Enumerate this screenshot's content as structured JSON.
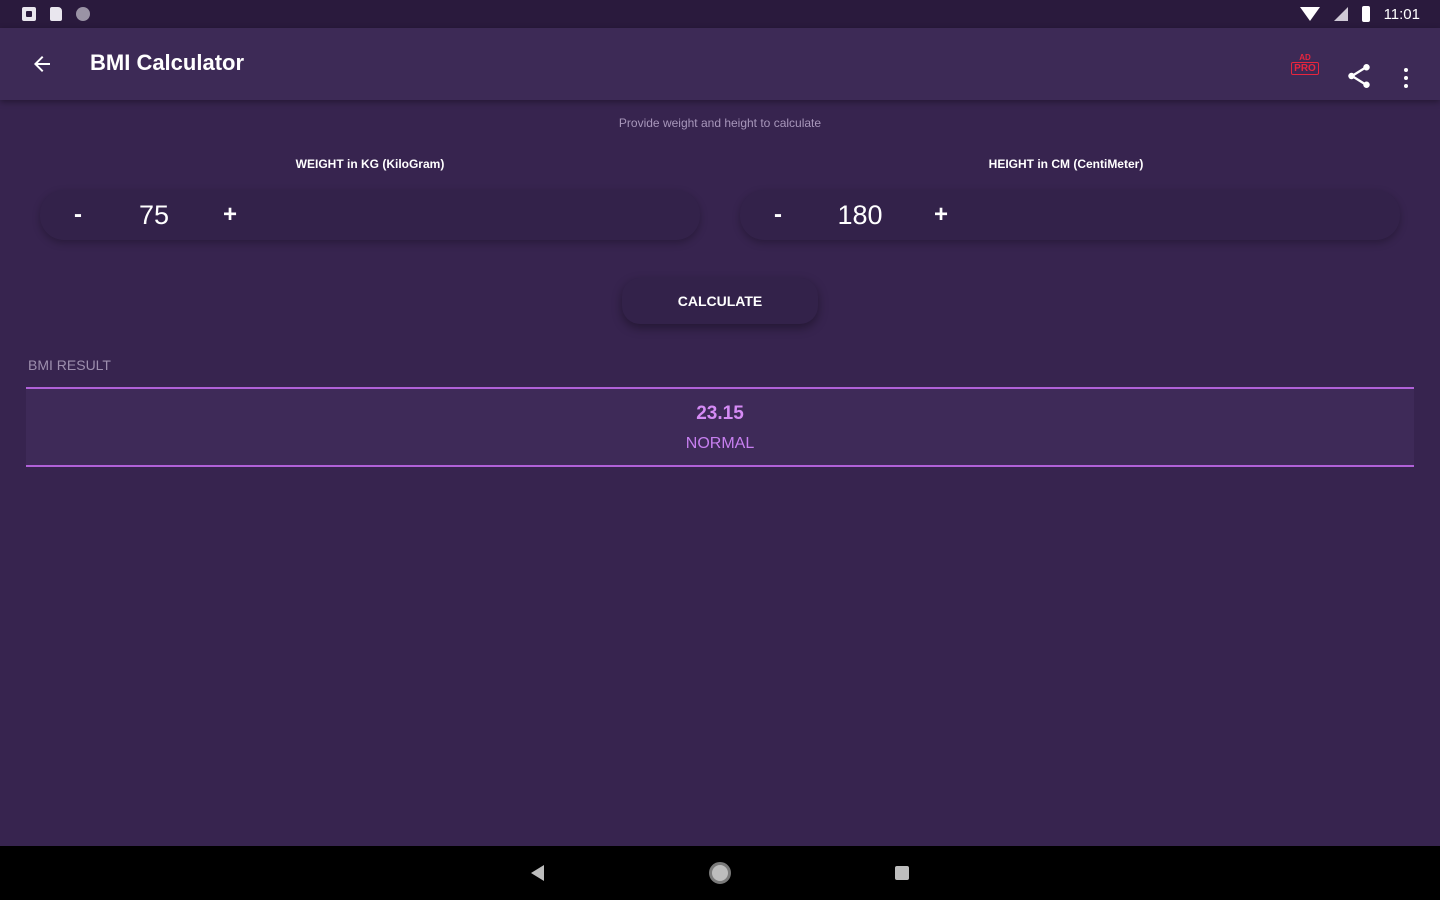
{
  "status_bar": {
    "time": "11:01",
    "icons": [
      "notification-icon",
      "sd-card-icon",
      "circle-icon",
      "wifi-icon",
      "signal-icon",
      "battery-icon"
    ]
  },
  "app_bar": {
    "title": "BMI Calculator",
    "back_icon": "arrow-left-icon",
    "pro_badge_ad": "AD",
    "pro_badge_text": "PRO",
    "share_icon": "share-icon",
    "menu_icon": "more-vert-icon"
  },
  "form": {
    "hint": "Provide weight and height to calculate",
    "weight": {
      "label": "WEIGHT in KG (KiloGram)",
      "minus": "-",
      "value": "75",
      "plus": "+"
    },
    "height": {
      "label": "HEIGHT in CM (CentiMeter)",
      "minus": "-",
      "value": "180",
      "plus": "+"
    },
    "calculate_label": "CALCULATE"
  },
  "result": {
    "label": "BMI RESULT",
    "value": "23.15",
    "status": "NORMAL"
  },
  "colors": {
    "background": "#37244f",
    "app_bar": "#3d2a56",
    "accent": "#b061d8",
    "result_text": "#d58bf5",
    "pro_badge": "#e8253e"
  },
  "nav_bar": {
    "icons": [
      "nav-back-icon",
      "nav-home-icon",
      "nav-recents-icon"
    ]
  }
}
